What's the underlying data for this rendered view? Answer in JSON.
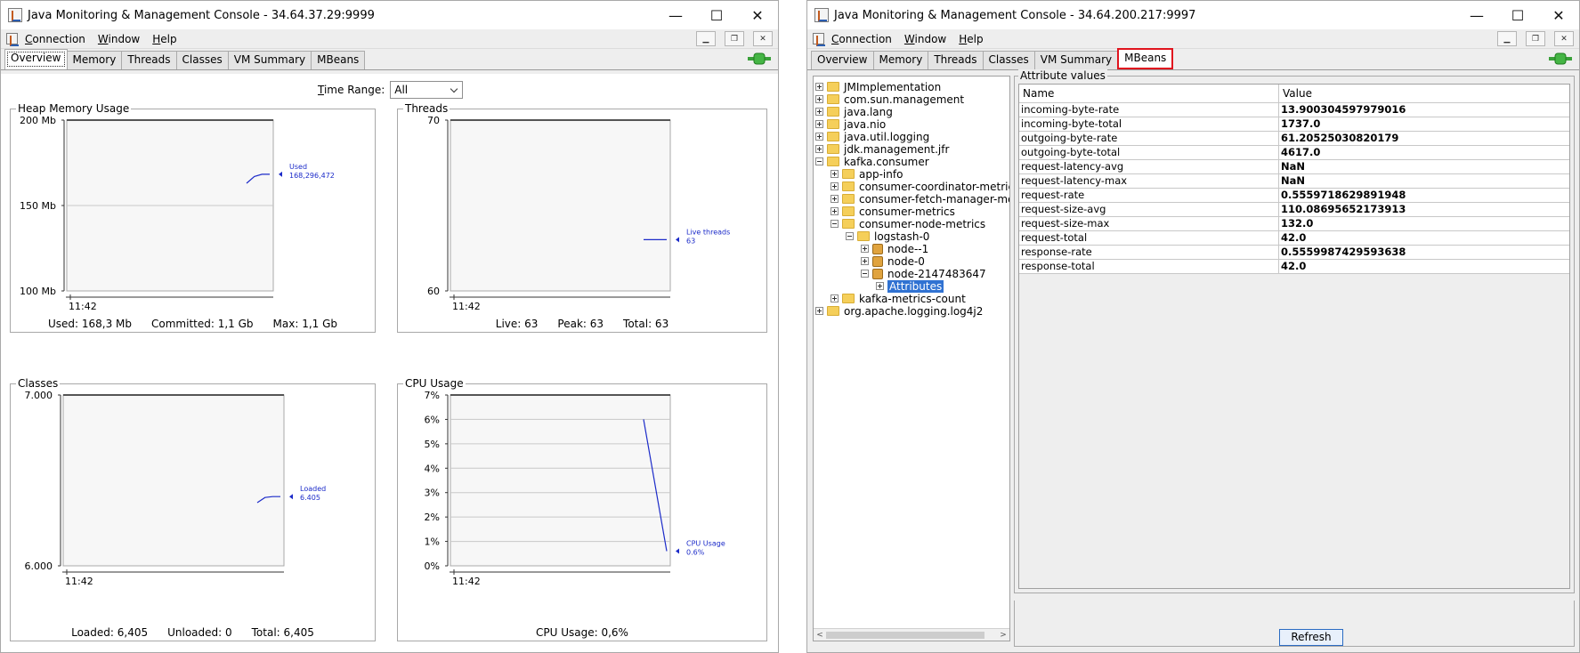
{
  "window1": {
    "title": "Java Monitoring & Management Console - 34.64.37.29:9999",
    "controls": {
      "minimize": "—",
      "maximize": "☐",
      "close": "✕"
    },
    "menu": [
      "Connection",
      "Window",
      "Help"
    ],
    "tabs": [
      "Overview",
      "Memory",
      "Threads",
      "Classes",
      "VM Summary",
      "MBeans"
    ],
    "active_tab": "Overview",
    "time_range": {
      "label": "Time Range:",
      "value": "All"
    },
    "panels": {
      "heap": {
        "title": "Heap Memory Usage",
        "footer": [
          "Used: 168,3 Mb",
          "Committed: 1,1 Gb",
          "Max: 1,1 Gb"
        ]
      },
      "threads": {
        "title": "Threads",
        "footer": [
          "Live: 63",
          "Peak: 63",
          "Total: 63"
        ]
      },
      "classes": {
        "title": "Classes",
        "footer": [
          "Loaded: 6,405",
          "Unloaded: 0",
          "Total: 6,405"
        ]
      },
      "cpu": {
        "title": "CPU Usage",
        "footer": [
          "CPU Usage: 0,6%"
        ]
      }
    }
  },
  "chart_data": [
    {
      "type": "line",
      "title": "Heap Memory Usage",
      "yticks": [
        "200 Mb",
        "150 Mb",
        "100 Mb"
      ],
      "ylim": [
        100,
        200
      ],
      "xticks": [
        "11:42"
      ],
      "series": [
        {
          "name": "Used",
          "label_value": "168,296,472",
          "values": [
            163,
            167,
            168.3,
            168.3
          ]
        }
      ],
      "color": "#1c2bc9"
    },
    {
      "type": "line",
      "title": "Threads",
      "yticks": [
        "70",
        "60"
      ],
      "ylim": [
        60,
        70
      ],
      "xticks": [
        "11:42"
      ],
      "series": [
        {
          "name": "Live threads",
          "label_value": "63",
          "values": [
            63,
            63
          ]
        }
      ],
      "color": "#1c2bc9"
    },
    {
      "type": "line",
      "title": "Classes",
      "yticks": [
        "7.000",
        "6.000"
      ],
      "ylim": [
        6000,
        7000
      ],
      "xticks": [
        "11:42"
      ],
      "series": [
        {
          "name": "Loaded",
          "label_value": "6.405",
          "values": [
            6370,
            6400,
            6405,
            6405
          ]
        }
      ],
      "color": "#1c2bc9"
    },
    {
      "type": "line",
      "title": "CPU Usage",
      "yticks": [
        "7%",
        "6%",
        "5%",
        "4%",
        "3%",
        "2%",
        "1%",
        "0%"
      ],
      "ylim": [
        0,
        7
      ],
      "xticks": [
        "11:42"
      ],
      "series": [
        {
          "name": "CPU Usage",
          "label_value": "0.6%",
          "values": [
            6.0,
            0.6
          ]
        }
      ],
      "color": "#1c2bc9"
    }
  ],
  "window2": {
    "title": "Java Monitoring & Management Console - 34.64.200.217:9997",
    "controls": {
      "minimize": "—",
      "maximize": "☐",
      "close": "✕"
    },
    "menu": [
      "Connection",
      "Window",
      "Help"
    ],
    "tabs": [
      "Overview",
      "Memory",
      "Threads",
      "Classes",
      "VM Summary",
      "MBeans"
    ],
    "active_tab": "MBeans",
    "tree": [
      {
        "label": "JMImplementation",
        "depth": 0,
        "kind": "folder",
        "exp": "plus"
      },
      {
        "label": "com.sun.management",
        "depth": 0,
        "kind": "folder",
        "exp": "plus"
      },
      {
        "label": "java.lang",
        "depth": 0,
        "kind": "folder",
        "exp": "plus"
      },
      {
        "label": "java.nio",
        "depth": 0,
        "kind": "folder",
        "exp": "plus"
      },
      {
        "label": "java.util.logging",
        "depth": 0,
        "kind": "folder",
        "exp": "plus"
      },
      {
        "label": "jdk.management.jfr",
        "depth": 0,
        "kind": "folder",
        "exp": "plus"
      },
      {
        "label": "kafka.consumer",
        "depth": 0,
        "kind": "folder",
        "exp": "minus"
      },
      {
        "label": "app-info",
        "depth": 1,
        "kind": "folder",
        "exp": "plus"
      },
      {
        "label": "consumer-coordinator-metrics",
        "depth": 1,
        "kind": "folder",
        "exp": "plus"
      },
      {
        "label": "consumer-fetch-manager-metrics",
        "depth": 1,
        "kind": "folder",
        "exp": "plus"
      },
      {
        "label": "consumer-metrics",
        "depth": 1,
        "kind": "folder",
        "exp": "plus"
      },
      {
        "label": "consumer-node-metrics",
        "depth": 1,
        "kind": "folder",
        "exp": "minus"
      },
      {
        "label": "logstash-0",
        "depth": 2,
        "kind": "folder",
        "exp": "minus"
      },
      {
        "label": "node--1",
        "depth": 3,
        "kind": "bean",
        "exp": "plus"
      },
      {
        "label": "node-0",
        "depth": 3,
        "kind": "bean",
        "exp": "plus"
      },
      {
        "label": "node-2147483647",
        "depth": 3,
        "kind": "bean",
        "exp": "minus"
      },
      {
        "label": "Attributes",
        "depth": 4,
        "kind": "none",
        "exp": "plus",
        "selected": true
      },
      {
        "label": "kafka-metrics-count",
        "depth": 1,
        "kind": "folder",
        "exp": "plus"
      },
      {
        "label": "org.apache.logging.log4j2",
        "depth": 0,
        "kind": "folder",
        "exp": "plus"
      }
    ],
    "attributes": {
      "title": "Attribute values",
      "headers": [
        "Name",
        "Value"
      ],
      "rows": [
        [
          "incoming-byte-rate",
          "13.900304597979016"
        ],
        [
          "incoming-byte-total",
          "1737.0"
        ],
        [
          "outgoing-byte-rate",
          "61.20525030820179"
        ],
        [
          "outgoing-byte-total",
          "4617.0"
        ],
        [
          "request-latency-avg",
          "NaN"
        ],
        [
          "request-latency-max",
          "NaN"
        ],
        [
          "request-rate",
          "0.5559718629891948"
        ],
        [
          "request-size-avg",
          "110.08695652173913"
        ],
        [
          "request-size-max",
          "132.0"
        ],
        [
          "request-total",
          "42.0"
        ],
        [
          "response-rate",
          "0.5559987429593638"
        ],
        [
          "response-total",
          "42.0"
        ]
      ]
    },
    "refresh_label": "Refresh"
  }
}
